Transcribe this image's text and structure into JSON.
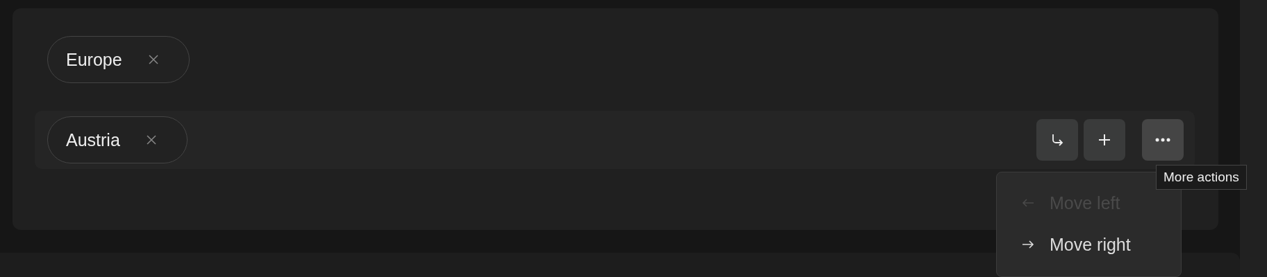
{
  "top_chips": [
    {
      "label": "Europe"
    }
  ],
  "rows": [
    {
      "chips": [
        {
          "label": "Austria"
        }
      ],
      "actions": [
        {
          "kind": "nest"
        },
        {
          "kind": "add"
        },
        {
          "kind": "more"
        }
      ]
    }
  ],
  "menu": {
    "items": [
      {
        "label": "Move left",
        "kind": "left",
        "disabled": true
      },
      {
        "label": "Move right",
        "kind": "right",
        "disabled": false
      }
    ]
  },
  "tooltip": "More actions"
}
